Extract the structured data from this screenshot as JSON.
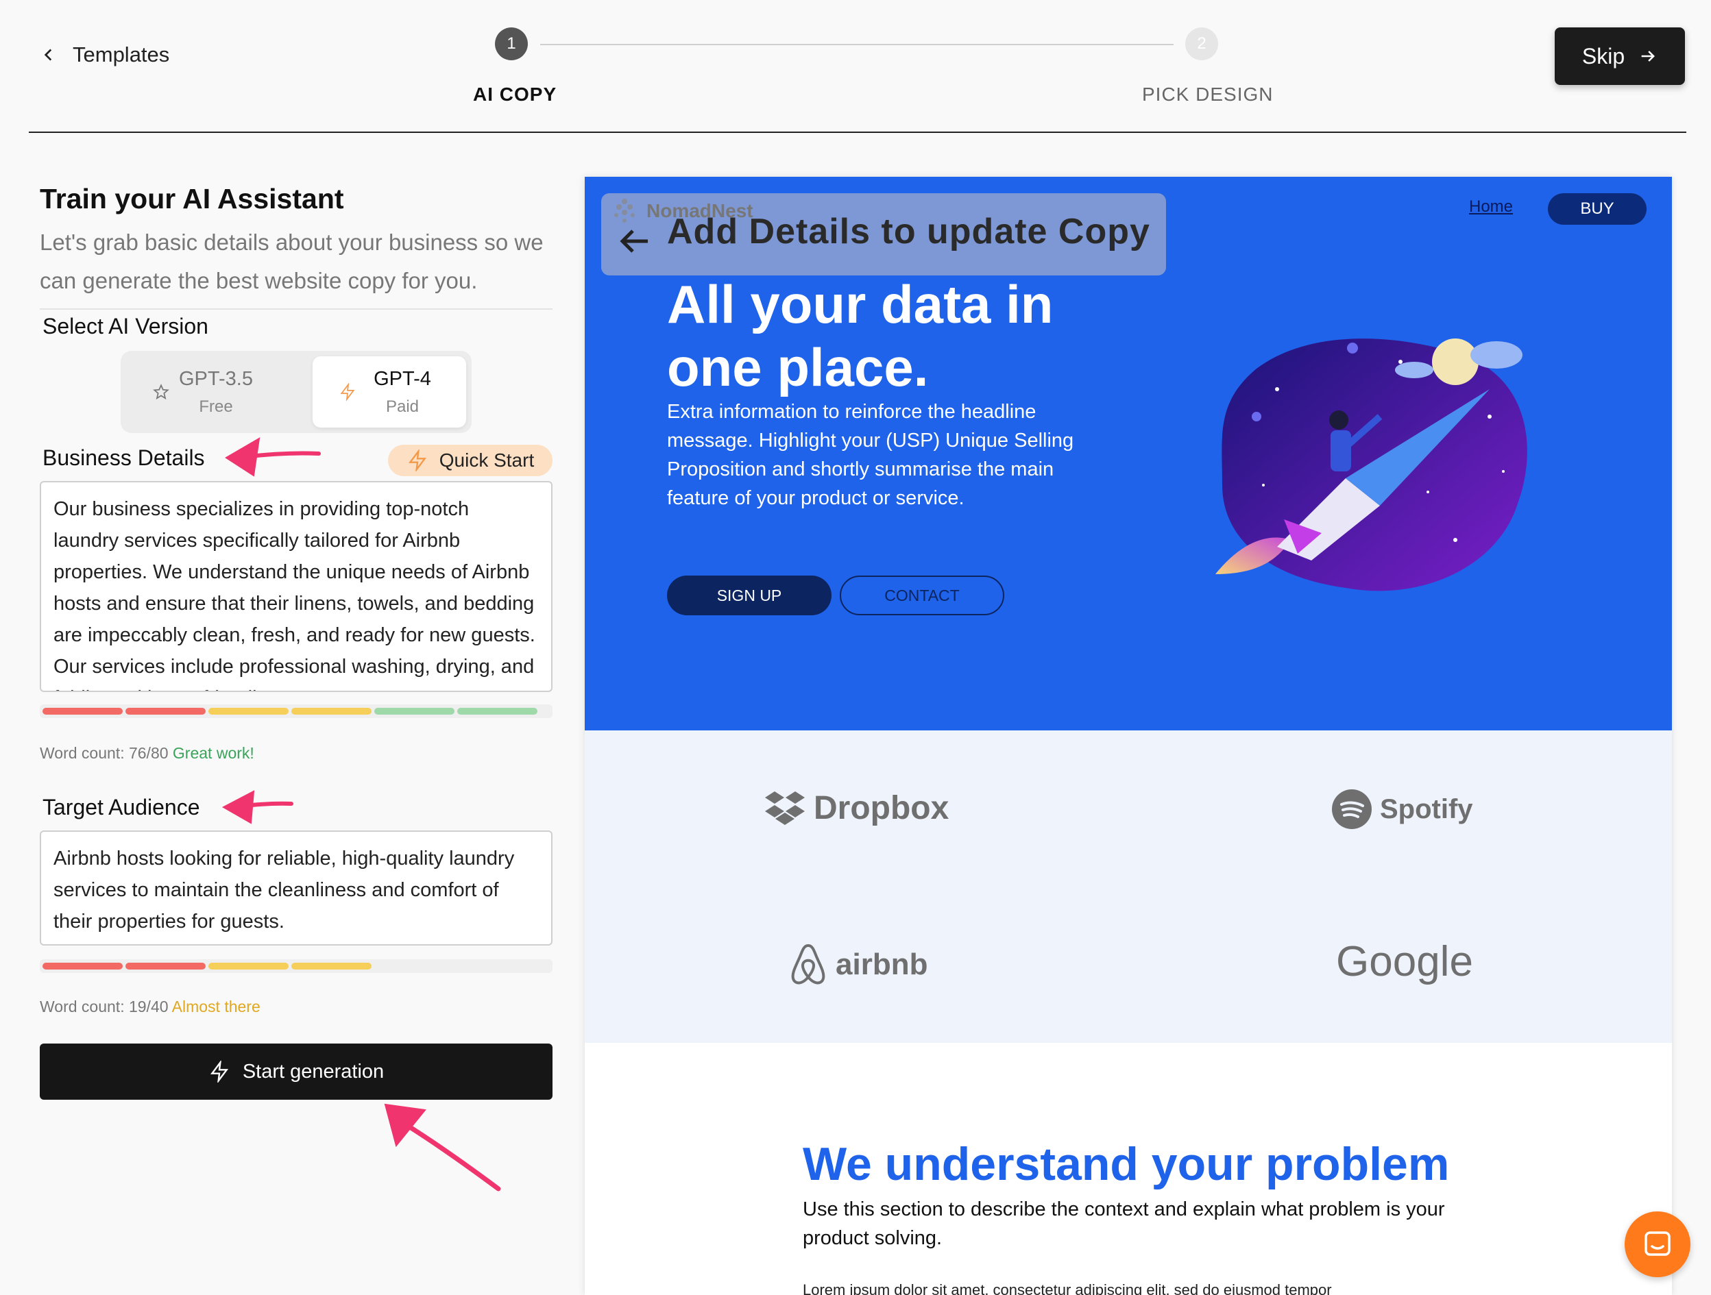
{
  "header": {
    "back_label": "Templates",
    "steps": [
      {
        "number": "1",
        "label": "AI COPY"
      },
      {
        "number": "2",
        "label": "PICK DESIGN"
      }
    ],
    "skip_label": "Skip"
  },
  "left": {
    "title": "Train your AI Assistant",
    "subtitle": "Let's grab basic details about your business so we can generate the best website copy for you.",
    "version_label": "Select AI Version",
    "versions": [
      {
        "name": "GPT-3.5",
        "sub": "Free",
        "icon": "star-icon",
        "selected": false
      },
      {
        "name": "GPT-4",
        "sub": "Paid",
        "icon": "bolt-icon",
        "selected": true
      }
    ],
    "business": {
      "label": "Business Details",
      "quick_start": "Quick Start",
      "text": "Our business specializes in providing top-notch laundry services specifically tailored for Airbnb properties. We understand the unique needs of Airbnb hosts and ensure that their linens, towels, and bedding are impeccably clean, fresh, and ready for new guests. Our services include professional washing, drying, and folding, with eco-friendly",
      "word_count": "Word count: 76/80",
      "status": "Great work!",
      "segments_filled": 6
    },
    "audience": {
      "label": "Target Audience",
      "text": "Airbnb hosts looking for reliable, high-quality laundry services to maintain the cleanliness and comfort of their properties for guests.",
      "word_count": "Word count: 19/40",
      "status": "Almost there",
      "segments_filled": 4
    },
    "generate_label": "Start generation"
  },
  "preview": {
    "banner_brand": "NomadNest",
    "banner_text": "Add Details to update Copy",
    "nav": {
      "home": "Home",
      "buy": "BUY"
    },
    "hero_title": "All your data in one place.",
    "hero_text": "Extra information to reinforce the headline message. Highlight your (USP) Unique Selling Proposition and shortly summarise the main feature of your product or service.",
    "signup": "SIGN UP",
    "contact": "CONTACT",
    "logos": [
      "Dropbox",
      "Spotify",
      "airbnb",
      "Google"
    ],
    "section_title": "We understand your problem",
    "section_text": "Use this section to describe the context and explain what problem is your product solving.",
    "lorem": "Lorem ipsum dolor sit amet, consectetur adipiscing elit, sed do eiusmod tempor"
  },
  "colors": {
    "hero_blue": "#1e63e9",
    "annotation_arrow": "#f0346e",
    "chat_orange": "#ff7a1a"
  }
}
